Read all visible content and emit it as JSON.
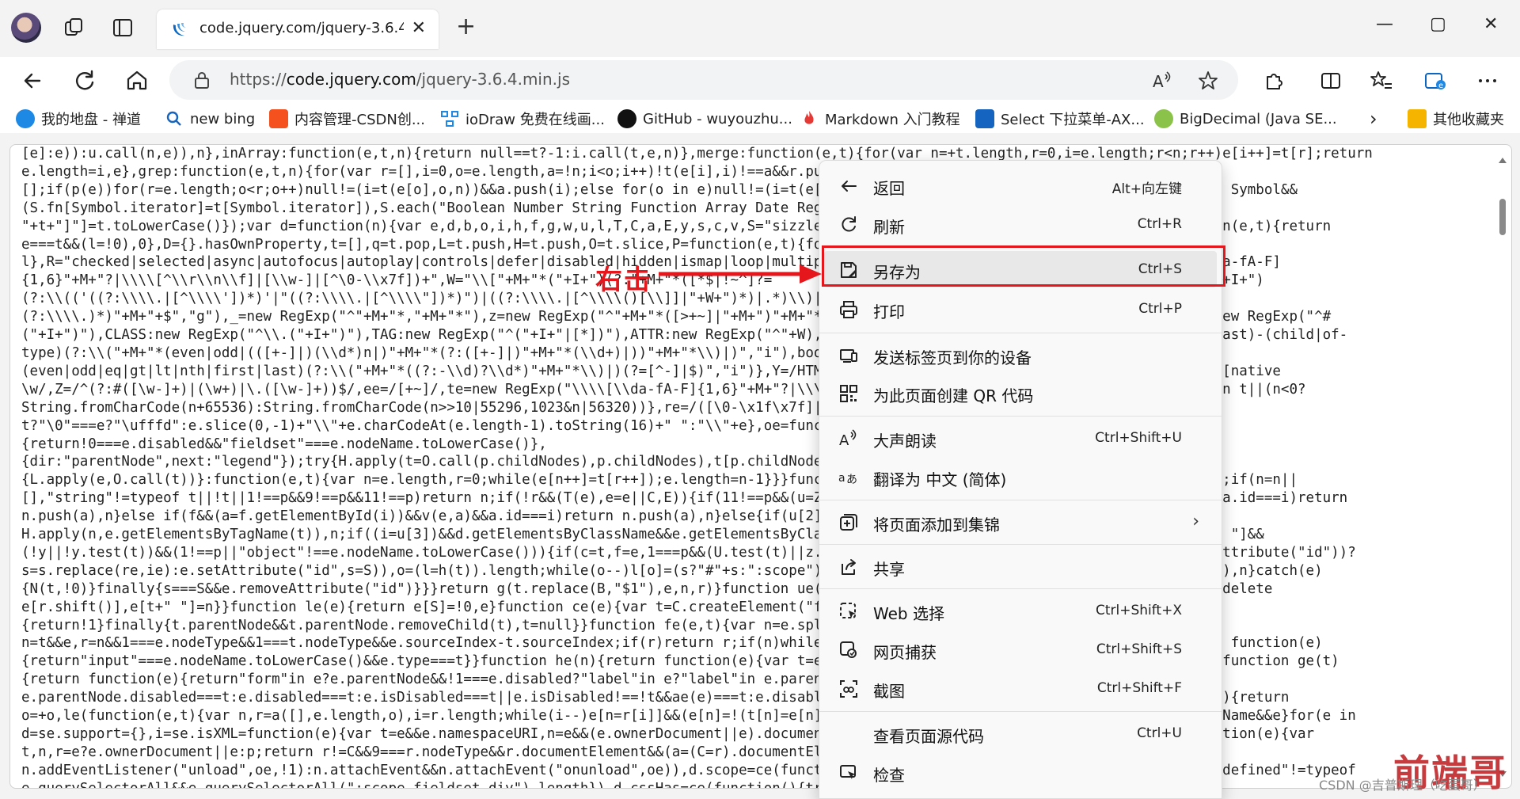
{
  "browser": {
    "tab_title": "code.jquery.com/jquery-3.6.4.m",
    "tab_close": "✕",
    "new_tab": "+",
    "window_controls": {
      "minimize": "—",
      "maximize": "▢",
      "close": "✕"
    },
    "url_prefix": "https://",
    "url_domain": "code.jquery.com",
    "url_path": "/jquery-3.6.4.min.js"
  },
  "favorites": [
    {
      "label": "我的地盘 - 禅道",
      "icon": "chandao-icon",
      "color": "#1e88e5"
    },
    {
      "label": "new bing",
      "icon": "search-icon",
      "color": "#1565c0"
    },
    {
      "label": "内容管理-CSDN创...",
      "icon": "csdn-icon",
      "color": "#f4511e"
    },
    {
      "label": "ioDraw 免费在线画...",
      "icon": "iodraw-icon",
      "color": "#1e88e5"
    },
    {
      "label": "GitHub - wuyouzhu...",
      "icon": "github-icon",
      "color": "#111111"
    },
    {
      "label": "Markdown 入门教程",
      "icon": "flame-icon",
      "color": "#e53935"
    },
    {
      "label": "Select 下拉菜单-AX...",
      "icon": "ax-icon",
      "color": "#1565c0"
    },
    {
      "label": "BigDecimal (Java SE...",
      "icon": "java-icon",
      "color": "#8bc34a"
    },
    {
      "label": "›",
      "icon": "chevron-right-icon",
      "color": "#333333"
    },
    {
      "label": "其他收藏夹",
      "icon": "folder-icon",
      "color": "#f5b400"
    }
  ],
  "code_lines": [
    "[e]:e)):u.call(n,e)),n},inArray:function(e,t,n){return null==t?-1:i.call(t,e,n)},merge:function(e,t){for(var n=+t.length,r=0,i=e.length;r<n;r++)e[i++]=t[r];return",
    "e.length=i,e},grep:function(e,t,n){for(var r=[],i=0,o=e.length,a=!n;i<o;i++)!t(e[i],i)!==a&&r.push(e[",
    "[];if(p(e))for(r=e.length;o<r;o++)null!=(i=t(e[o],o,n))&&a.push(i);else for(o in e)null!=(i=t(e[o],o,                            nction\"==typeof Symbol&&",
    "(S.fn[Symbol.iterator]=t[Symbol.iterator]),S.each(\"Boolean Number String Function Array Date RegExp O                            bject",
    "\"+t+\"]\"]=t.toLowerCase()});var d=function(n){var e,d,b,o,i,h,f,g,w,u,l,T,C,a,E,y,s,c,v,S=\"sizzle\"+1*n                            =ue(),j=function(e,t){return",
    "e===t&&(l=!0),0},D={}.hasOwnProperty,t=[],q=t.pop,L=t.push,H=t.push,O=t.slice,P=function(e,t){for(var",
    "l},R=\"checked|selected|async|autofocus|autoplay|controls|defer|disabled|hidden|ismap|loop|multiple|op                            ,I=\"(?:\\\\\\\\[\\\\da-fA-F]",
    "{1,6}\"+M+\"?|\\\\\\\\[^\\\\r\\\\n\\\\f]|[\\\\w-]|[^\\0-\\\\x7f])+\",W=\"\\\\[\"+M+\"*(\"+I+\")(?:\"+M+\"*([*$|!~^]?=                            \"+I+\"))|)\"+M+\"*\\\\]\",F=\":(\"+I+\")",
    "(?:\\\\(('((?:\\\\\\\\.|[^\\\\\\\\'])*)'|\"((?:\\\\\\\\.|[^\\\\\\\\\"])*)\")|((?:\\\\\\\\.|[^\\\\\\\\()[\\\\]]|\"+W+\")*)|.*)\\\\)|)                            ^[^\\\\\\\\])",
    "(?:\\\\\\\\.)*)\"+M+\"+$\",\"g\"),_=new RegExp(\"^\"+M+\"*,\"+M+\"*\"),z=new RegExp(\"^\"+M+\"*([>+~]|\"+M+\")\"+M+\"*\"),U=                            +I+\"$\"),G={ID:new RegExp(\"^#",
    "(\"+I+\")\"),CLASS:new RegExp(\"^\\\\.(\"+I+\")\"),TAG:new RegExp(\"^(\"+I+\"|[*])\"),ATTR:new RegExp(\"^\"+W),PSEUD                            |last|nth|nth-last)-(child|of-",
    "type)(?:\\\\(\"+M+\"*(even|odd|(([+-]|)(\\\\d*)n|)\"+M+\"*(?:([+-]|)\"+M+\"*(\\\\d+)|))\"+M+\"*\\\\)|)\",\"i\"),bool:new                            ^\"+M+\"*[>+~]|:",
    "(even|odd|eq|gt|lt|nth|first|last)(?:\\\\(\"+M+\"*((?:-\\\\d)?\\\\d*)\"+M+\"*\\\\)|)(?=[^-]|$)\",\"i\")},Y=/HTML$/i,                            K=/^[^{]+\\{\\s*\\[native",
    "\\w/,Z=/^(?:#([\\w-]+)|(\\w+)|\\.([\\w-]+))$/,ee=/[+~]/,te=new RegExp(\"\\\\\\\\[\\\\da-fA-F]{1,6}\"+M+\"?|\\\\\\\\([^                            e(1)-65536;return t||(n<0?",
    "String.fromCharCode(n+65536):String.fromCharCode(n>>10|55296,1023&n|56320))},re=/([\\0-\\x1f\\x7f]|^-?\\d                            return",
    "t?\"\\0\"===e?\"\\ufffd\":e.slice(0,-1)+\"\\\\\"+e.charCodeAt(e.length-1).toString(16)+\" \":\"\\\\\"+e},oe=function(",
    "{return!0===e.disabled&&\"fieldset\"===e.nodeName.toLowerCase()},",
    "{dir:\"parentNode\",next:\"legend\"});try{H.apply(t=O.call(p.childNodes),p.childNodes),t[p.childNodes.len                            e,t)",
    "{L.apply(e,O.call(t))}:function(e,t){var n=e.length,r=0;while(e[n++]=t[r++]);e.length=n-1}}}function                            p=e?e.nodeType:9;if(n=n||",
    "[],\"string\"!=typeof t||!t||1!==p&&9!==p&&11!==p)return n;if(!r&&(T(e),e=e||C,E)){if(11!==p&&(u=Z.exec                            )))return n;if(a.id===i)return",
    "n.push(a),n}else if(f&&(a=f.getElementById(i))&&v(e,a)&&a.id===i)return n.push(a),n}else{if(u[2])retur",
    "H.apply(n,e.getElementsByTagName(t)),n;if((i=u[3])&&d.getElementsByClassName&&e.getElementsByClassNam                            f(d.qsa&&!N[t+\" \"]&&",
    "(!y||!y.test(t))&&(1!==p||\"object\"!==e.nodeName.toLowerCase())){if(c=t,f=e,1===p&&(U.test(t)||z.test(                            ope||((s=e.getAttribute(\"id\"))?",
    "s=s.replace(re,ie):e.setAttribute(\"id\",s=S)),o=(l=h(t)).length;while(o--)l[o]=(s?\"#\"+s:\":scope\")+\" \"+                            rSelectorAll(c)),n}catch(e)",
    "{N(t,!0)}finally{s===S&&e.removeAttribute(\"id\")}}}return g(t.replace(B,\"$1\"),e,n,r)}function ue(){var                            e.cacheLength&&delete",
    "e[r.shift()],e[t+\" \"]=n}}function le(e){return e[S]=!0,e}function ce(e){var t=C.createElement(\"fields",
    "{return!1}finally{t.parentNode&&t.parentNode.removeChild(t),t=null}}function fe(e,t){var n=e.split(\"                            on pe(e,t){var",
    "n=t&&e,r=n&&1===e.nodeType&&1===t.nodeType&&e.sourceIndex-t.sourceIndex;if(r)return r;if(n)while(n=n.                            on de(t){return function(e)",
    "{return\"input\"===e.nodeName.toLowerCase()&&e.type===t}}function he(n){return function(e){var t=e.node                            )&&e.type===n}}function ge(t)",
    "{return function(e){return\"form\"in e?e.parentNode&&!1===e.disabled?\"label\"in e?\"label\"in e.parentNode",
    "e.parentNode.disabled===t:e.disabled===t:e.isDisabled===t||e.isDisabled!==!t&&ae(e)===t:e.disabled===                            n le(function(o){return",
    "o=+o,le(function(e,t){var n,r=a([],e.length,o),i=r.length;while(i--)e[n=r[i]]&&(e[n]=!(t[n]=e[n]))})}                            etElementsByTagName&&e}for(e in",
    "d=se.support={},i=se.isXML=function(e){var t=e&&e.namespaceURI,n=e&&(e.ownerDocument||e).documentElem                            etDocument=function(e){var",
    "t,n,r=e?e.ownerDocument||e:p;return r!=C&&9===r.nodeType&&r.documentElement&&(a=(C=r).documentElement                            EventListener?",
    "n.addEventListener(\"unload\",oe,!1):n.attachEvent&&n.attachEvent(\"onunload\",oe)),d.scope=ce(function(e                            ent(\"div\")),\"undefined\"!=typeof",
    "e.querySelectorAll&&e.querySelectorAll(\":scope fieldset div\").length}),d.cssHas=ce(function(){try{ret"
  ],
  "context_menu": {
    "items": [
      {
        "label": "返回",
        "shortcut": "Alt+向左键",
        "icon": "back-arrow-icon"
      },
      {
        "label": "刷新",
        "shortcut": "Ctrl+R",
        "icon": "refresh-icon"
      },
      {
        "label": "另存为",
        "shortcut": "Ctrl+S",
        "icon": "save-as-icon"
      },
      {
        "label": "打印",
        "shortcut": "Ctrl+P",
        "icon": "printer-icon"
      },
      {
        "label": "发送标签页到你的设备",
        "shortcut": "",
        "icon": "send-to-device-icon"
      },
      {
        "label": "为此页面创建 QR 代码",
        "shortcut": "",
        "icon": "qr-code-icon"
      },
      {
        "label": "大声朗读",
        "shortcut": "Ctrl+Shift+U",
        "icon": "read-aloud-icon"
      },
      {
        "label": "翻译为 中文 (简体)",
        "shortcut": "",
        "icon": "translate-icon"
      },
      {
        "label": "将页面添加到集锦",
        "shortcut": "",
        "icon": "collections-icon",
        "submenu": "›"
      },
      {
        "label": "共享",
        "shortcut": "",
        "icon": "share-icon"
      },
      {
        "label": "Web 选择",
        "shortcut": "Ctrl+Shift+X",
        "icon": "web-select-icon"
      },
      {
        "label": "网页捕获",
        "shortcut": "Ctrl+Shift+S",
        "icon": "web-capture-icon"
      },
      {
        "label": "截图",
        "shortcut": "Ctrl+Shift+F",
        "icon": "screenshot-icon"
      },
      {
        "label": "查看页面源代码",
        "shortcut": "Ctrl+U",
        "icon": ""
      },
      {
        "label": "检查",
        "shortcut": "",
        "icon": "inspect-icon"
      }
    ]
  },
  "annotation": {
    "text": "右击",
    "highlight_color": "#e5161c"
  },
  "watermark": {
    "text": "前端哥",
    "credit": "CSDN @吉普斯理（吃蛋哥）"
  },
  "colors": {
    "accent": "#e5161c",
    "menu_bg": "#f9f9f9",
    "chrome_bg": "#f3f3f3"
  }
}
